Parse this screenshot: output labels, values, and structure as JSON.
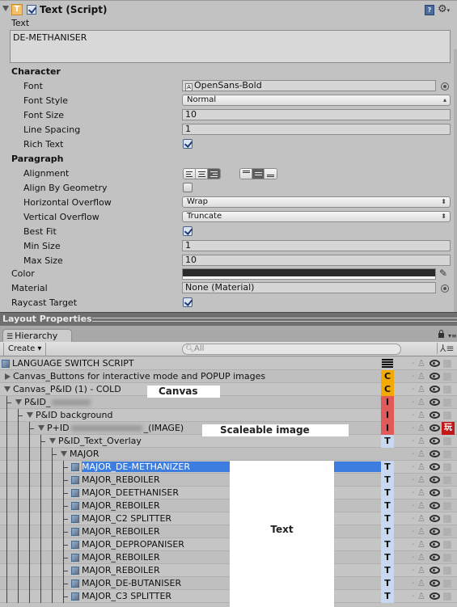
{
  "inspector": {
    "component_title": "Text (Script)",
    "component_icon": "T",
    "component_enabled": true,
    "text_label": "Text",
    "text_value": "DE-METHANISER",
    "character_section": "Character",
    "font_label": "Font",
    "font_value": "OpenSans-Bold",
    "font_style_label": "Font Style",
    "font_style_value": "Normal",
    "font_size_label": "Font Size",
    "font_size_value": "10",
    "line_spacing_label": "Line Spacing",
    "line_spacing_value": "1",
    "rich_text_label": "Rich Text",
    "rich_text_checked": true,
    "paragraph_section": "Paragraph",
    "alignment_label": "Alignment",
    "alignment_horizontal": "right",
    "alignment_vertical": "middle",
    "align_by_geometry_label": "Align By Geometry",
    "align_by_geometry_checked": false,
    "horizontal_overflow_label": "Horizontal Overflow",
    "horizontal_overflow_value": "Wrap",
    "vertical_overflow_label": "Vertical Overflow",
    "vertical_overflow_value": "Truncate",
    "best_fit_label": "Best Fit",
    "best_fit_checked": true,
    "min_size_label": "Min Size",
    "min_size_value": "1",
    "max_size_label": "Max Size",
    "max_size_value": "10",
    "color_label": "Color",
    "color_value": "#2c2c2c",
    "material_label": "Material",
    "material_value": "None (Material)",
    "raycast_target_label": "Raycast Target",
    "raycast_target_checked": true
  },
  "layout_bar": {
    "title": "Layout Properties"
  },
  "hierarchy": {
    "tab_label": "Hierarchy",
    "create_label": "Create",
    "search_placeholder": "All",
    "rows": [
      {
        "name": "LANGUAGE SWITCH SCRIPT",
        "badge": "script",
        "badge_label": ""
      },
      {
        "name": "Canvas_Buttons for interactive mode and POPUP images",
        "badge": "canvas",
        "badge_label": "C"
      },
      {
        "name": "Canvas_P&ID (1) - COLD",
        "badge": "canvas",
        "badge_label": "C"
      },
      {
        "name_prefix": "P&ID_",
        "name_suffix": "",
        "badge": "image",
        "badge_label": "I"
      },
      {
        "name": "P&ID background",
        "badge": "image",
        "badge_label": "I"
      },
      {
        "name_prefix": "P+ID",
        "name_suffix": "_(IMAGE)",
        "badge": "image",
        "badge_label": "I"
      },
      {
        "name": "P&ID_Text_Overlay",
        "badge": "text",
        "badge_label": "T"
      },
      {
        "name": "MAJOR",
        "badge": "",
        "badge_label": ""
      },
      {
        "name": "MAJOR_DE-METHANIZER",
        "badge": "text",
        "badge_label": "T",
        "selected": true
      },
      {
        "name": "MAJOR_REBOILER",
        "badge": "text",
        "badge_label": "T"
      },
      {
        "name": "MAJOR_DEETHANISER",
        "badge": "text",
        "badge_label": "T"
      },
      {
        "name": "MAJOR_REBOILER",
        "badge": "text",
        "badge_label": "T"
      },
      {
        "name": "MAJOR_C2 SPLITTER",
        "badge": "text",
        "badge_label": "T"
      },
      {
        "name": "MAJOR_REBOILER",
        "badge": "text",
        "badge_label": "T"
      },
      {
        "name": "MAJOR_DEPROPANISER",
        "badge": "text",
        "badge_label": "T"
      },
      {
        "name": "MAJOR_REBOILER",
        "badge": "text",
        "badge_label": "T"
      },
      {
        "name": "MAJOR_REBOILER",
        "badge": "text",
        "badge_label": "T"
      },
      {
        "name": "MAJOR_DE-BUTANISER",
        "badge": "text",
        "badge_label": "T"
      },
      {
        "name": "MAJOR_C3 SPLITTER",
        "badge": "text",
        "badge_label": "T"
      }
    ],
    "play_badge_label": "玩"
  },
  "annotations": {
    "canvas": "Canvas",
    "scaleable_image": "Scaleable image",
    "text": "Text"
  },
  "colors": {
    "selection": "#3e7de0",
    "canvas_badge": "#f2a900",
    "image_badge": "#e15a5a",
    "text_badge": "#c9d8f1"
  }
}
